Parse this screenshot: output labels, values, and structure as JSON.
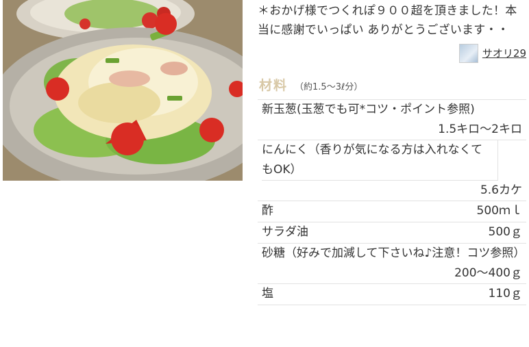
{
  "photo": {
    "icon": "salad-photo"
  },
  "description": "＊おかげ様でつくれぽ９００超を頂きました！本当に感謝でいっぱい ありがとうございます・・",
  "author": {
    "name": "サオリ29",
    "icon": "user-avatar"
  },
  "ingredients": {
    "title": "材料",
    "serving": "（約1.5〜3ℓ分）",
    "items": [
      {
        "name": "新玉葱(玉葱でも可*コツ・ポイント参照)",
        "qty": "1.5キロ〜2キロ"
      },
      {
        "name": "にんにく（香りが気になる方は入れなくてもOK）",
        "qty": "5.6カケ"
      },
      {
        "name": "酢",
        "qty": "500ｍｌ"
      },
      {
        "name": "サラダ油",
        "qty": "500ｇ"
      },
      {
        "name": "砂糖（好みで加減して下さいね♪注意！コツ参照）",
        "qty": "200〜400ｇ"
      },
      {
        "name": "塩",
        "qty": "110ｇ"
      }
    ]
  }
}
